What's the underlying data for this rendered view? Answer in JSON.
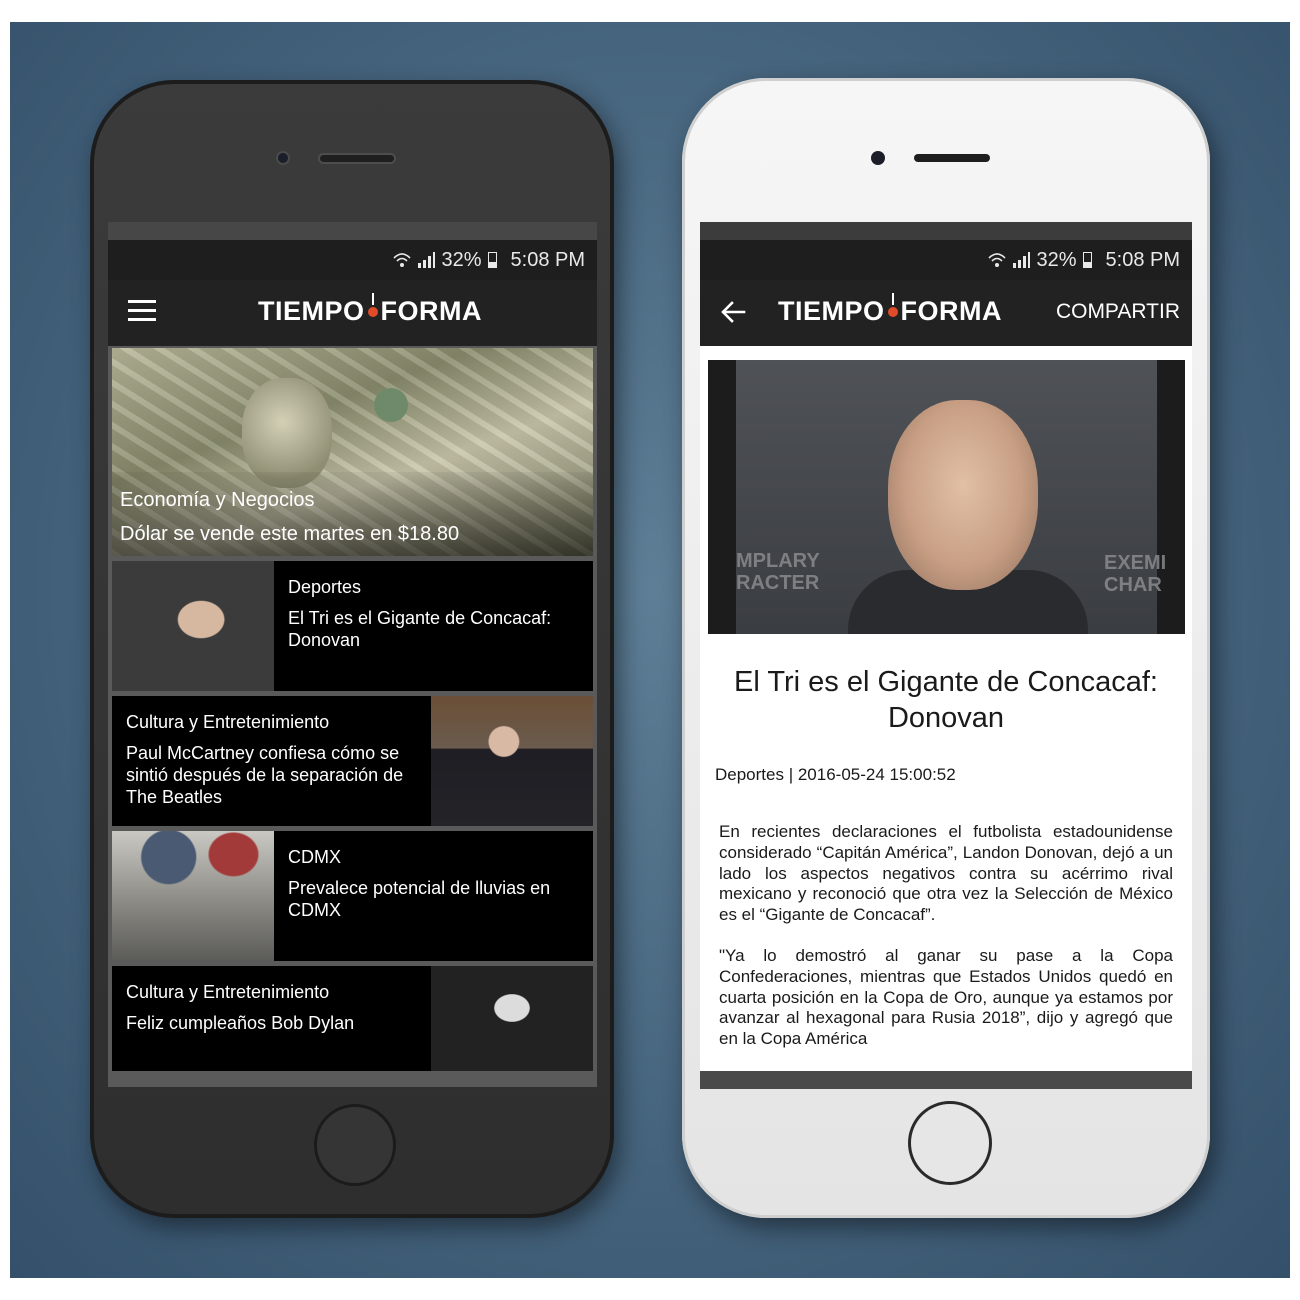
{
  "status_bar": {
    "battery": "32%",
    "time": "5:08 PM"
  },
  "app": {
    "logo_left": "TIEMPO",
    "logo_right": "FORMA"
  },
  "feed": {
    "hero": {
      "category": "Economía y Negocios",
      "title": "Dólar se vende este martes en $18.80"
    },
    "items": [
      {
        "category": "Deportes",
        "title": "El Tri es el Gigante de Concacaf: Donovan",
        "image": "donovan-photo"
      },
      {
        "category": "Cultura y Entretenimiento",
        "title": "Paul McCartney confiesa cómo se sintió después de la separación de The Beatles",
        "image": "mccartney-photo"
      },
      {
        "category": "CDMX",
        "title": "Prevalece potencial de lluvias en CDMX",
        "image": "rain-umbrellas-photo"
      },
      {
        "category": "Cultura y Entretenimiento",
        "title": "Feliz cumpleaños Bob Dylan",
        "image": "dylan-photo"
      }
    ]
  },
  "article": {
    "share_label": "COMPARTIR",
    "title": "El Tri es el Gigante de Concacaf: Donovan",
    "meta": "Deportes | 2016-05-24 15:00:52",
    "watermark_left": "MPLARY\nRACTER",
    "watermark_right": "EXEMI\nCHAR",
    "paragraphs": [
      "En recientes declaraciones el futbolista estadounidense considerado “Capitán América”, Landon Donovan, dejó a un lado los aspectos negativos contra su acérrimo rival mexicano y reconoció que otra vez la Selección de México es el “Gigante de Concacaf”.",
      "\"Ya lo demostró al ganar su pase a la Copa Confederaciones, mientras que Estados Unidos quedó en cuarta posición en la Copa de Oro, aunque ya estamos por avanzar al hexagonal para Rusia 2018”, dijo y agregó que en la Copa América"
    ]
  },
  "colors": {
    "backdrop": "#4a6982",
    "logo_accent": "#e04b2a",
    "card_bg": "#000000"
  },
  "icons": [
    "menu-icon",
    "back-arrow-icon",
    "wifi-icon",
    "signal-icon",
    "battery-icon"
  ]
}
